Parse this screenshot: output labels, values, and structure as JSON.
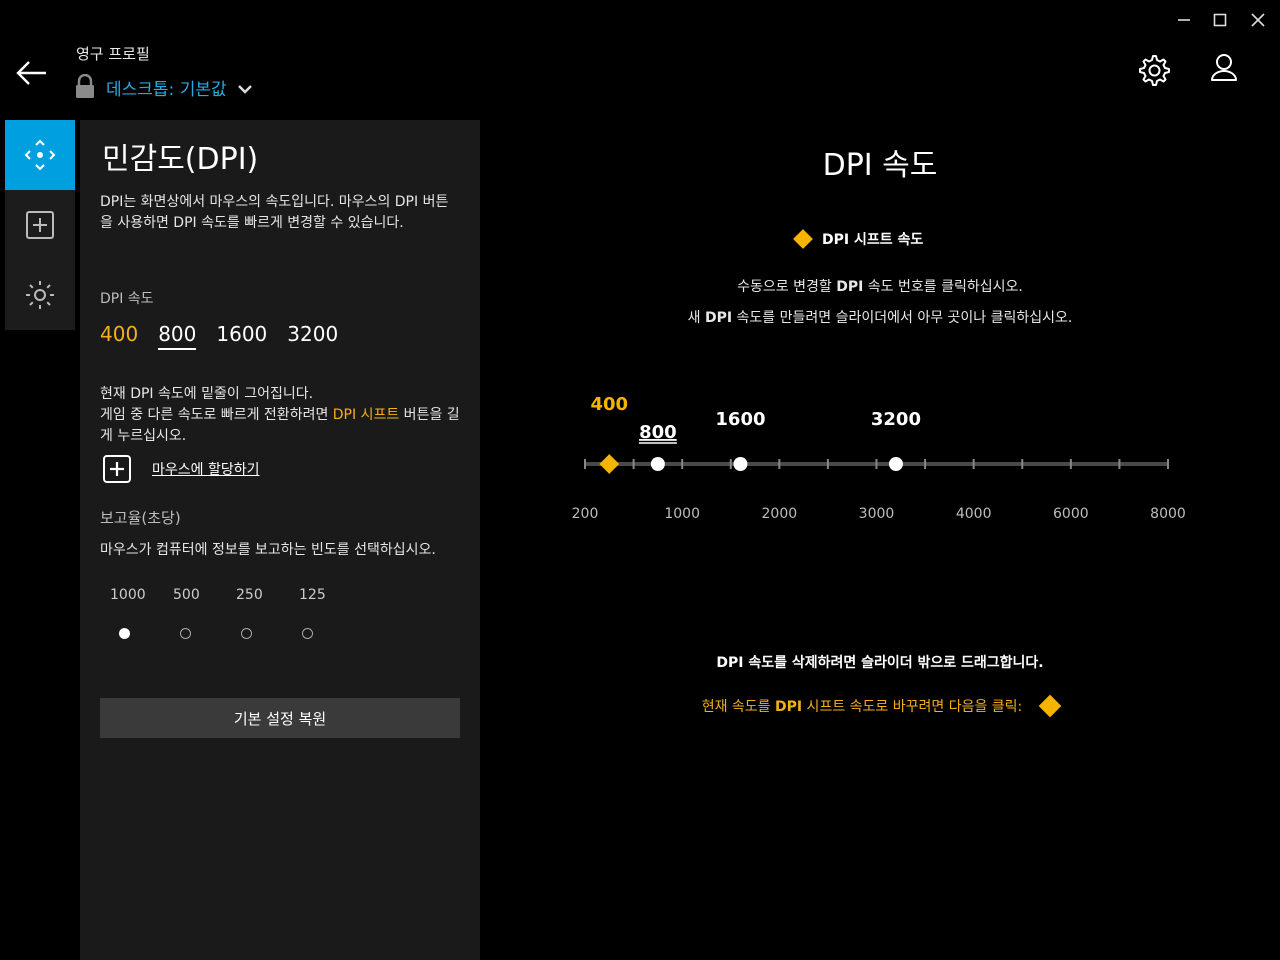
{
  "window": {
    "minimize": "—",
    "maximize": "☐",
    "close": "✕"
  },
  "header": {
    "profile_label": "영구 프로필",
    "profile_name": "데스크톱: 기본값"
  },
  "rail": {
    "items": [
      {
        "icon": "move-arrows-icon",
        "active": true
      },
      {
        "icon": "plus-box-icon",
        "active": false
      },
      {
        "icon": "sun-lighting-icon",
        "active": false
      }
    ]
  },
  "panel": {
    "title": "민감도(DPI)",
    "description": "DPI는 화면상에서 마우스의 속도입니다. 마우스의 DPI 버튼을 사용하면 DPI 속도를 빠르게 변경할 수 있습니다.",
    "dpi_label": "DPI 속도",
    "dpi_levels": [
      {
        "label": "400",
        "shift": true,
        "current": false
      },
      {
        "label": "800",
        "shift": false,
        "current": true
      },
      {
        "label": "1600",
        "shift": false,
        "current": false
      },
      {
        "label": "3200",
        "shift": false,
        "current": false
      }
    ],
    "info_line1": "현재 DPI 속도에 밑줄이 그어집니다.",
    "info_line2_pre": "게임 중 다른 속도로 빠르게 전환하려면 ",
    "info_line2_highlight": "DPI 시프트",
    "info_line2_post": " 버튼을 길게 누르십시오.",
    "assign_link": "마우스에 할당하기",
    "report_label": "보고율(초당)",
    "report_desc": "마우스가 컴퓨터에 정보를 보고하는 빈도를 선택하십시오.",
    "report_rates": [
      "1000",
      "500",
      "250",
      "125"
    ],
    "report_selected": "1000",
    "reset_button": "기본 설정 복원"
  },
  "main": {
    "title": "DPI 속도",
    "legend_label": "DPI 시프트 속도",
    "instr_line1_pre": "수동으로 변경할 ",
    "instr_line1_bold": "DPI",
    "instr_line1_post": " 속도 번호를 클릭하십시오.",
    "instr_line2_pre": "새 ",
    "instr_line2_bold": "DPI",
    "instr_line2_post": " 속도를 만들려면 슬라이더에서 아무 곳이나 클릭하십시오.",
    "delete_hint": "DPI 속도를 삭제하려면 슬라이더 밖으로 드래그합니다.",
    "shift_hint_pre": "현재 속도를 ",
    "shift_hint_bold": "DPI",
    "shift_hint_post": " 시프트 속도로 바꾸려면 다음을 클릭:"
  },
  "slider": {
    "scale_labels": [
      "200",
      "1000",
      "2000",
      "3000",
      "4000",
      "6000",
      "8000"
    ],
    "points": [
      {
        "value": 400,
        "label": "400",
        "type": "shift"
      },
      {
        "value": 800,
        "label": "800",
        "type": "current"
      },
      {
        "value": 1600,
        "label": "1600",
        "type": "normal"
      },
      {
        "value": 3200,
        "label": "3200",
        "type": "normal"
      }
    ]
  },
  "colors": {
    "accent": "#00a0e0",
    "shift": "#f5b400",
    "link_blue": "#29a9e1"
  }
}
